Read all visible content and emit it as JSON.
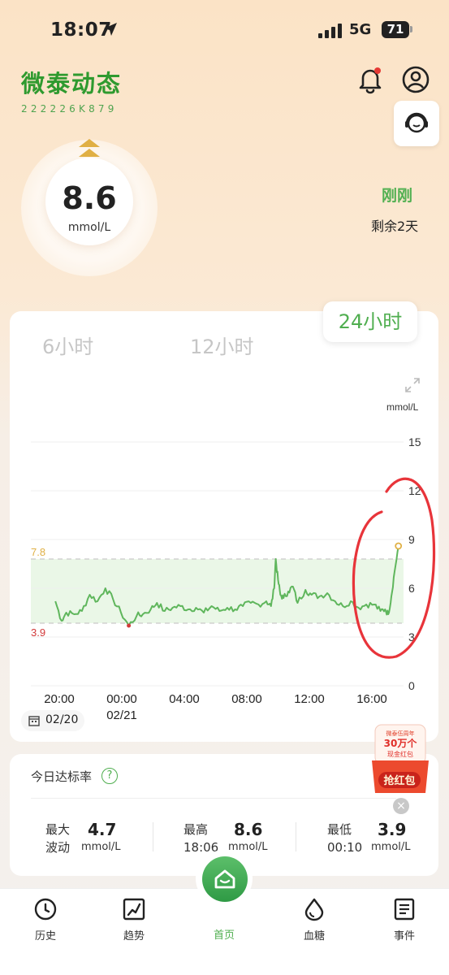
{
  "status_bar": {
    "time": "18:07",
    "network": "5G",
    "battery": "71"
  },
  "header": {
    "title": "微泰动态",
    "device_id": "222226K879"
  },
  "glucose": {
    "value": "8.6",
    "unit": "mmol/L",
    "trend": "rising",
    "update_time": "刚刚",
    "remaining": "剩余2天"
  },
  "chart": {
    "tabs": [
      {
        "label": "6小时"
      },
      {
        "label": "12小时"
      },
      {
        "label": "24小时"
      }
    ],
    "selected_tab": "24小时",
    "date_chip": "02/20"
  },
  "chart_data": {
    "type": "line",
    "ylabel": "mmol/L",
    "ylim": [
      0,
      15
    ],
    "yticks": [
      "15",
      "12",
      "9",
      "6",
      "3",
      "0"
    ],
    "xticks": [
      {
        "label": "20:00",
        "sub": ""
      },
      {
        "label": "00:00",
        "sub": "02/21"
      },
      {
        "label": "04:00",
        "sub": ""
      },
      {
        "label": "08:00",
        "sub": ""
      },
      {
        "label": "12:00",
        "sub": ""
      },
      {
        "label": "16:00",
        "sub": ""
      }
    ],
    "target_range": {
      "low": "3.9",
      "high": "7.8",
      "low_value": 3.9,
      "high_value": 7.8
    },
    "x_hours": [
      -0.2,
      0.2,
      0.5,
      1,
      1.5,
      2,
      2.5,
      3,
      3.5,
      4,
      4.5,
      5,
      5.4,
      5.9,
      6.3,
      6.8,
      7.3,
      7.8,
      8.3,
      8.8,
      9.3,
      9.8,
      10.3,
      10.8,
      11.3,
      11.8,
      12.3,
      12.8,
      13.3,
      13.6,
      13.8,
      13.9,
      14.05,
      14.2,
      14.4,
      14.7,
      15,
      15.3,
      15.8,
      16.2,
      16.7,
      17.2,
      17.7,
      18.2,
      18.7,
      19.2,
      19.7,
      20.2,
      20.6,
      20.9,
      21.1,
      21.3,
      21.5,
      21.75
    ],
    "values": [
      5.2,
      4.0,
      4.5,
      4.4,
      4.6,
      5.6,
      5.2,
      6.0,
      5.3,
      4.5,
      3.7,
      4.3,
      4.4,
      4.7,
      5.1,
      4.6,
      4.8,
      4.9,
      4.7,
      4.8,
      4.5,
      4.9,
      4.6,
      4.8,
      4.7,
      4.9,
      5.1,
      5.0,
      5.2,
      4.9,
      6.0,
      7.8,
      6.5,
      5.6,
      5.4,
      5.8,
      6.1,
      5.1,
      5.9,
      5.6,
      5.5,
      5.7,
      5.2,
      4.9,
      5.2,
      4.8,
      5.0,
      5.0,
      4.6,
      4.7,
      4.4,
      5.5,
      7.0,
      8.6
    ],
    "current": {
      "hour": 21.75,
      "value": 8.6
    }
  },
  "stats": {
    "title": "今日达标率",
    "items": [
      {
        "label1": "最大",
        "label2": "波动",
        "value": "4.7",
        "unit": "mmol/L"
      },
      {
        "label1": "最高",
        "label2": "18:06",
        "value": "8.6",
        "unit": "mmol/L"
      },
      {
        "label1": "最低",
        "label2": "00:10",
        "value": "3.9",
        "unit": "mmol/L"
      }
    ]
  },
  "promo": {
    "top": "微泰伍周年",
    "main": "30万个",
    "sub": "现金红包",
    "button": "抢红包"
  },
  "tabbar": [
    {
      "label": "历史",
      "icon": "history-icon"
    },
    {
      "label": "趋势",
      "icon": "trend-icon"
    },
    {
      "label": "首页",
      "icon": "home-icon"
    },
    {
      "label": "血糖",
      "icon": "blood-drop-icon"
    },
    {
      "label": "事件",
      "icon": "event-list-icon"
    }
  ],
  "colors": {
    "primary_green": "#4fae4f",
    "line_green": "#5fb65c",
    "low_red": "#d23a3a",
    "high_yellow": "#e8b84d",
    "annotation_red": "#e8343a"
  }
}
